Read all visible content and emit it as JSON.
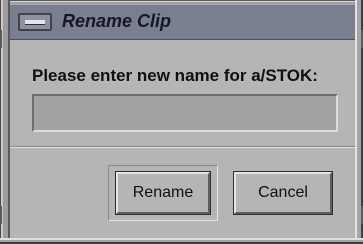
{
  "dialog": {
    "title": "Rename Clip",
    "prompt": "Please enter new name for a/STOK:",
    "input": {
      "value": "",
      "placeholder": ""
    },
    "buttons": {
      "rename_label": "Rename",
      "cancel_label": "Cancel"
    },
    "default_button": "Rename"
  },
  "colors": {
    "titlebar": "#7a7f90",
    "background": "#b5b5b5",
    "input_field": "#a3a3a3",
    "text": "#101010"
  },
  "icons": {
    "window_menu": "window-menu-icon"
  }
}
